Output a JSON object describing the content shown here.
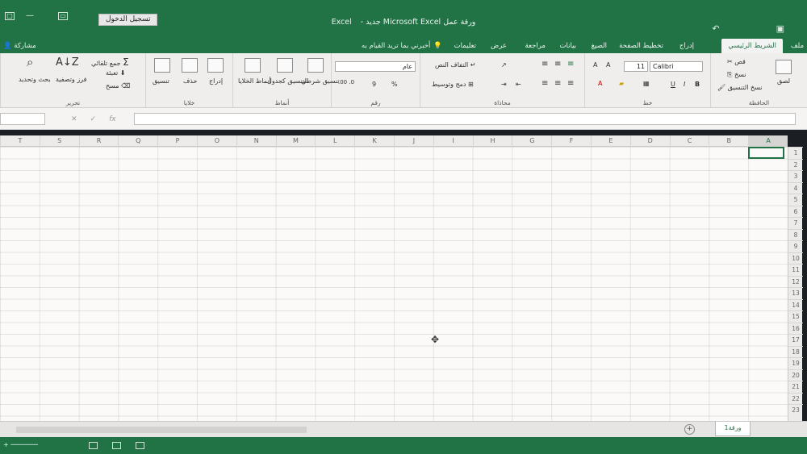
{
  "titlebar": {
    "signin": "تسجيل الدخول",
    "workbook": "ورقة عمل Microsoft Excel جديد",
    "separator": "-",
    "app": "Excel"
  },
  "tabs": {
    "file": "ملف",
    "home": "الشريط الرئيسي",
    "insert": "إدراج",
    "page_layout": "تخطيط الصفحة",
    "formulas": "الصيغ",
    "data": "بيانات",
    "review": "مراجعة",
    "view": "عرض",
    "help": "تعليمات",
    "tell_me": "أخبرني بما تريد القيام به",
    "share": "مشاركة"
  },
  "ribbon": {
    "clipboard": {
      "label": "الحافظة",
      "paste": "لصق",
      "cut": "قص",
      "copy": "نسخ",
      "format_painter": "نسخ التنسيق"
    },
    "font": {
      "label": "خط",
      "name": "Calibri",
      "size": "11",
      "bold": "B",
      "italic": "I",
      "underline": "U",
      "grow": "A",
      "shrink": "A"
    },
    "alignment": {
      "label": "محاذاة",
      "wrap": "التفاف النص",
      "merge": "دمج وتوسيط"
    },
    "number": {
      "label": "رقم",
      "format": "عام",
      "percent": "%",
      "comma": "9"
    },
    "styles": {
      "label": "أنماط",
      "conditional": "تنسيق شرطي",
      "format_table": "التنسيق كجدول",
      "cell_styles": "أنماط الخلايا"
    },
    "cells": {
      "label": "خلايا",
      "insert": "إدراج",
      "delete": "حذف",
      "format": "تنسيق"
    },
    "editing": {
      "label": "تحرير",
      "autosum": "جمع تلقائي",
      "fill": "تعبئة",
      "clear": "مسح",
      "sort_filter": "فرز وتصفية",
      "find_select": "بحث وتحديد"
    }
  },
  "formula_bar": {
    "fx": "fx",
    "cancel": "✕",
    "enter": "✓"
  },
  "columns": [
    "A",
    "B",
    "C",
    "D",
    "E",
    "F",
    "G",
    "H",
    "I",
    "J",
    "K",
    "L",
    "M",
    "N",
    "O",
    "P",
    "Q",
    "R",
    "S",
    "T"
  ],
  "rows": [
    "1",
    "2",
    "3",
    "4",
    "5",
    "6",
    "7",
    "8",
    "9",
    "10",
    "11",
    "12",
    "13",
    "14",
    "15",
    "16",
    "17",
    "18",
    "19",
    "20",
    "21",
    "22",
    "23"
  ],
  "sheet": {
    "tab_name": "ورقة1",
    "add": "+"
  },
  "colors": {
    "accent": "#217346",
    "ribbon_bg": "#efeeec",
    "grid_bg": "#fbfaf8"
  },
  "icons": {
    "restore": "restore-icon",
    "minimize": "minimize-icon",
    "close": "close-icon",
    "search": "search-icon",
    "lightbulb": "lightbulb-icon"
  }
}
